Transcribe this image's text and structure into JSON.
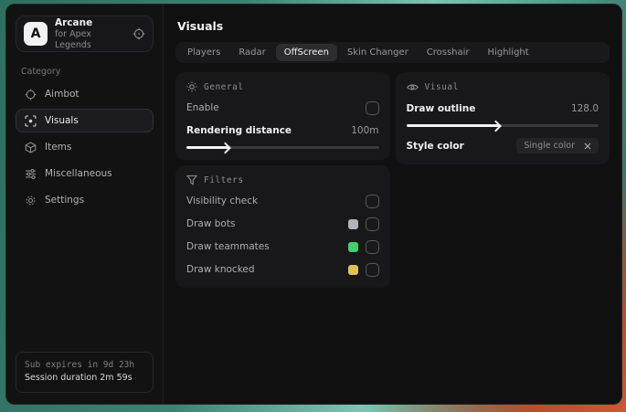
{
  "app": {
    "logo_letter": "A",
    "name": "Arcane",
    "subtitle": "for Apex Legends"
  },
  "sidebar": {
    "category_label": "Category",
    "items": [
      {
        "label": "Aimbot",
        "active": false
      },
      {
        "label": "Visuals",
        "active": true
      },
      {
        "label": "Items",
        "active": false
      },
      {
        "label": "Miscellaneous",
        "active": false
      },
      {
        "label": "Settings",
        "active": false
      }
    ],
    "status_line1": "Sub expires in 9d 23h",
    "status_line2": "Session duration 2m 59s"
  },
  "main": {
    "title": "Visuals",
    "active_tab": "OffScreen",
    "tabs": [
      {
        "label": "Players"
      },
      {
        "label": "Radar"
      },
      {
        "label": "OffScreen"
      },
      {
        "label": "Skin Changer"
      },
      {
        "label": "Crosshair"
      },
      {
        "label": "Highlight"
      }
    ]
  },
  "general_panel": {
    "title": "General",
    "enable_label": "Enable",
    "enable_checked": false,
    "rendering_distance_label": "Rendering distance",
    "rendering_distance_value": "100m",
    "rendering_distance_percent": 22
  },
  "visual_panel": {
    "title": "Visual",
    "draw_outline_label": "Draw outline",
    "draw_outline_value": "128.0",
    "draw_outline_percent": 48,
    "style_color_label": "Style color",
    "style_color_value": "Single color"
  },
  "filters_panel": {
    "title": "Filters",
    "rows": [
      {
        "label": "Visibility check",
        "swatch": null,
        "checked": false
      },
      {
        "label": "Draw bots",
        "swatch": "#b0b4ba",
        "checked": false
      },
      {
        "label": "Draw teammates",
        "swatch": "#41d06e",
        "checked": false
      },
      {
        "label": "Draw knocked",
        "swatch": "#e0c254",
        "checked": false
      }
    ]
  },
  "colors": {
    "accent_fill": "#f2f2f2",
    "panel_bg": "#18181a",
    "game_bg_teal": "#3c8273",
    "game_bg_orange": "#c8502e"
  }
}
